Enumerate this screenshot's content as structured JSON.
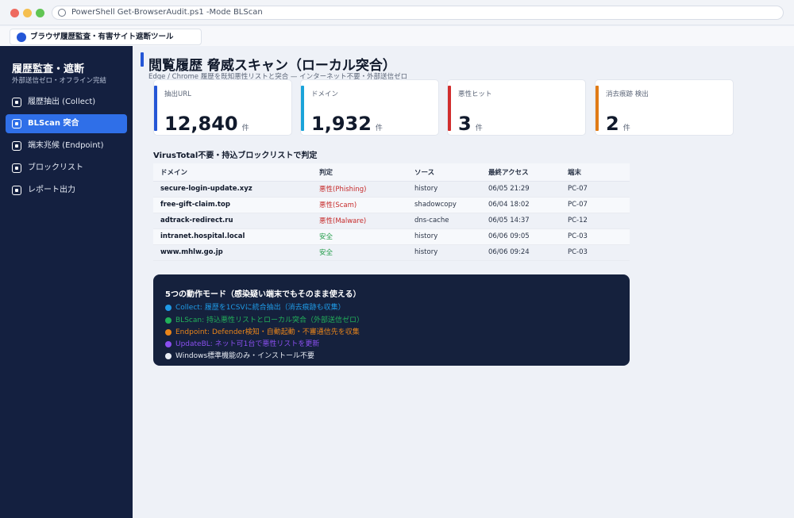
{
  "window": {
    "address": "PowerShell  Get-BrowserAudit.ps1  -Mode BLScan",
    "tab_title": "ブラウザ履歴監査・有害サイト遮断ツール"
  },
  "sidebar": {
    "title": "履歴監査・遮断",
    "subtitle": "外部送信ゼロ・オフライン完結",
    "items": [
      {
        "label": "履歴抽出 (Collect)"
      },
      {
        "label": "BLScan 突合"
      },
      {
        "label": "端末兆候 (Endpoint)"
      },
      {
        "label": "ブロックリスト"
      },
      {
        "label": "レポート出力"
      }
    ]
  },
  "header": {
    "title": "閲覧履歴 脅威スキャン（ローカル突合）",
    "subtitle": "Edge / Chrome 履歴を既知悪性リストと突合 — インターネット不要・外部送信ゼロ"
  },
  "stats": [
    {
      "label": "抽出URL",
      "value": "12,840",
      "unit": "件",
      "color": "#2456d6"
    },
    {
      "label": "ドメイン",
      "value": "1,932",
      "unit": "件",
      "color": "#1aa3d9"
    },
    {
      "label": "悪性ヒット",
      "value": "3",
      "unit": "件",
      "color": "#d12e2e"
    },
    {
      "label": "消去痕跡 検出",
      "value": "2",
      "unit": "件",
      "color": "#e07b16"
    }
  ],
  "table": {
    "title": "VirusTotal不要・持込ブロックリストで判定",
    "headers": [
      "ドメイン",
      "判定",
      "ソース",
      "最終アクセス",
      "端末"
    ],
    "rows": [
      {
        "domain": "secure-login-update.xyz",
        "verdict": "悪性(Phishing)",
        "source": "history",
        "last": "06/05 21:29",
        "host": "PC-07"
      },
      {
        "domain": "free-gift-claim.top",
        "verdict": "悪性(Scam)",
        "source": "shadowcopy",
        "last": "06/04 18:02",
        "host": "PC-07"
      },
      {
        "domain": "adtrack-redirect.ru",
        "verdict": "悪性(Malware)",
        "source": "dns-cache",
        "last": "06/05 14:37",
        "host": "PC-12"
      },
      {
        "domain": "intranet.hospital.local",
        "verdict": "安全",
        "source": "history",
        "last": "06/06 09:05",
        "host": "PC-03"
      },
      {
        "domain": "www.mhlw.go.jp",
        "verdict": "安全",
        "source": "history",
        "last": "06/06 09:24",
        "host": "PC-03"
      }
    ]
  },
  "modes": {
    "title": "5つの動作モード（感染疑い端末でもそのまま使える）",
    "items": [
      {
        "text": "Collect: 履歴を1CSVに統合抽出（消去痕跡も収集）",
        "color": "#1f9ae6"
      },
      {
        "text": "BLScan: 持込悪性リストとローカル突合（外部送信ゼロ）",
        "color": "#22b05a"
      },
      {
        "text": "Endpoint: Defender検知・自動起動・不審通信先を収集",
        "color": "#e8841a"
      },
      {
        "text": "UpdateBL: ネット可1台で悪性リストを更新",
        "color": "#8b4ff0"
      },
      {
        "text": "Windows標準機能のみ・インストール不要",
        "color": "#e9edf5"
      }
    ]
  }
}
